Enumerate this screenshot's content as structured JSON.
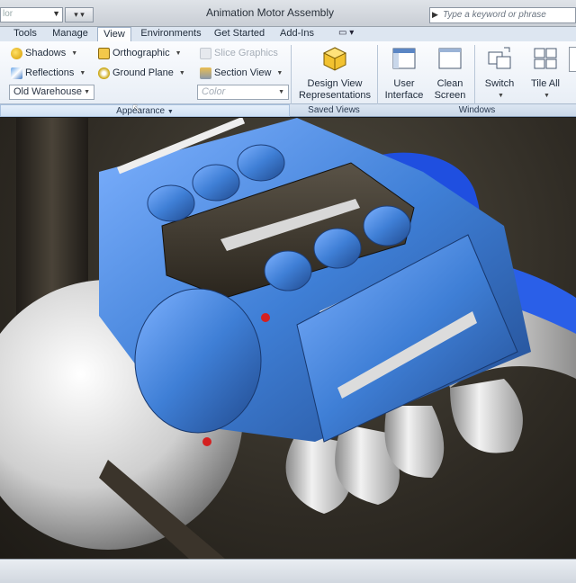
{
  "titlebar": {
    "combo_text": "lor",
    "title": "Animation Motor Assembly",
    "search_placeholder": "Type a keyword or phrase"
  },
  "tabs": [
    {
      "label": "Tools"
    },
    {
      "label": "Manage"
    },
    {
      "label": "View",
      "active": true
    },
    {
      "label": "Environments"
    },
    {
      "label": "Get Started"
    },
    {
      "label": "Add-Ins"
    }
  ],
  "appearance": {
    "shadows": "Shadows",
    "reflections": "Reflections",
    "visual_style": "Old Warehouse",
    "orthographic": "Orthographic",
    "ground_plane": "Ground Plane",
    "slice_graphics": "Slice Graphics",
    "section_view": "Section View",
    "color": "Color",
    "panel_title": "Appearance"
  },
  "saved_views": {
    "design_view_line1": "Design View",
    "design_view_line2": "Representations",
    "panel_title": "Saved Views"
  },
  "windows": {
    "user_interface_line1": "User",
    "user_interface_line2": "Interface",
    "clean_screen_line1": "Clean",
    "clean_screen_line2": "Screen",
    "switch": "Switch",
    "tile_all": "Tile All",
    "panel_title": "Windows"
  },
  "colors": {
    "engine_blue": "#3f7fd6",
    "ribbon_bg": "#eef3f9",
    "viewport_bg": "#3a352c"
  }
}
